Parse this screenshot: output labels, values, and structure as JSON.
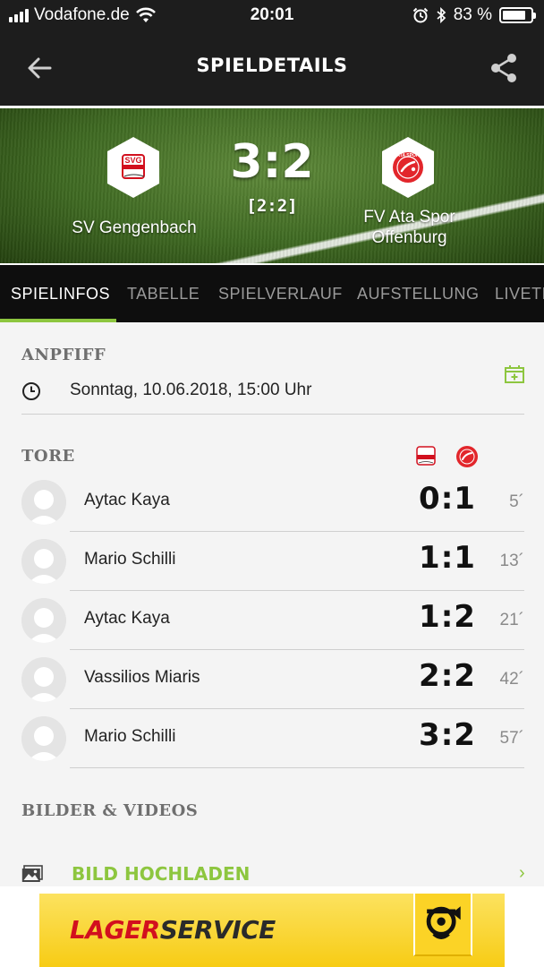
{
  "status_bar": {
    "carrier": "Vodafone.de",
    "time": "20:01",
    "battery": "83 %",
    "battery_level": 0.83
  },
  "nav": {
    "title": "SPIELDETAILS",
    "back_icon": "back-arrow-icon",
    "share_icon": "share-icon"
  },
  "match": {
    "home_team": "SV Gengenbach",
    "away_team_line1": "FV Ata Spor",
    "away_team_line2": "Offenburg",
    "score": "3:2",
    "halftime": "[2:2]",
    "home_logo_text": "SVG",
    "away_logo_text": "ATA SPOR"
  },
  "tabs": [
    {
      "label": "SPIELINFOS"
    },
    {
      "label": "TABELLE"
    },
    {
      "label": "SPIELVERLAUF"
    },
    {
      "label": "AUFSTELLUNG"
    },
    {
      "label": "LIVETICKER"
    }
  ],
  "anpfiff": {
    "heading": "ANPFIFF",
    "datetime": "Sonntag, 10.06.2018, 15:00 Uhr"
  },
  "tore": {
    "heading": "TORE",
    "goals": [
      {
        "scorer": "Aytac Kaya",
        "score": "0:1",
        "minute": "5´"
      },
      {
        "scorer": "Mario Schilli",
        "score": "1:1",
        "minute": "13´"
      },
      {
        "scorer": "Aytac Kaya",
        "score": "1:2",
        "minute": "21´"
      },
      {
        "scorer": "Vassilios Miaris",
        "score": "2:2",
        "minute": "42´"
      },
      {
        "scorer": "Mario Schilli",
        "score": "3:2",
        "minute": "57´"
      }
    ]
  },
  "media": {
    "heading": "BILDER & VIDEOS",
    "upload_label": "BILD HOCHLADEN",
    "chevron": "›"
  },
  "ad": {
    "text_red": "LAGER",
    "text_dark": "SERVICE"
  },
  "colors": {
    "accent": "#8dc63f",
    "bar": "#1d1d1d",
    "away_red": "#e2262b",
    "ad_yellow": "#fcd21c"
  }
}
